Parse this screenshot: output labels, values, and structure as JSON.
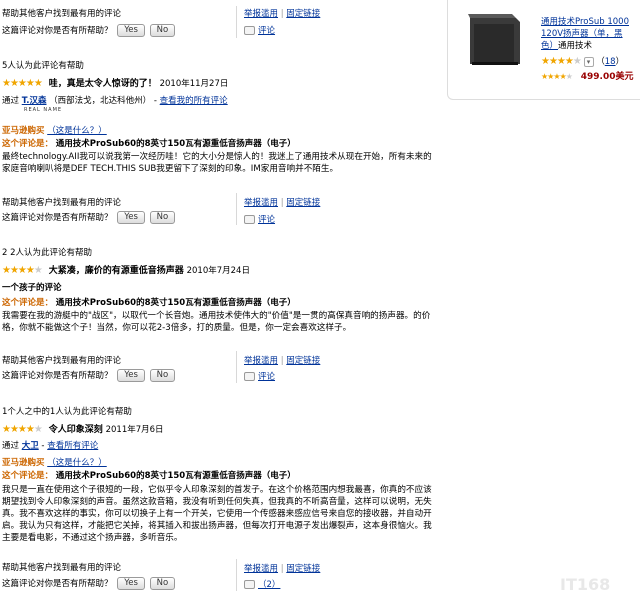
{
  "common": {
    "help_others": "帮助其他客户找到最有用的评论",
    "was_helpful": "这篇评论对你是否有所帮助？",
    "yes": "Yes",
    "no": "No",
    "report_abuse": "举报滥用",
    "permalink": "固定链接",
    "comment": "评论",
    "amazon_verified": "亚马逊购买",
    "whats_this": "（这是什么？）",
    "this_review_is": "这个评论是："
  },
  "product": {
    "title_line1": "通用技术ProSub 1000",
    "title_line2": "120V扬声器（单，黑",
    "title_line3_link": "色）",
    "brand": "通用技术",
    "rating_count_prefix": "（",
    "rating_count": "18",
    "rating_count_suffix": "）",
    "price": "499.00美元"
  },
  "reviews": [
    {
      "helpful_count": "5人认为此评论有帮助",
      "title": "哇，真是太令人惊讶的了！",
      "date": "2010年11月27日",
      "by": "通过",
      "reviewer": "T.汉森",
      "location": "（西部法戈，北达科他州）",
      "dash": " - ",
      "see_all": "查看我的所有评论",
      "real_name": "REAL NAME",
      "product_name": "通用技术ProSub60的8英寸150瓦有源重低音扬声器（电子）",
      "body": "最终technology.AII我可以说我第一次经历哇！它的大小分是惊人的！我迷上了通用技术从现在开始，所有未来的家庭音响喇叭将是DEF TECH.THIS SUB我更留下了深刻的印象。IM家用音响并不陌生。",
      "comment_count": ""
    },
    {
      "helpful_count": "2 2人认为此评论有帮助",
      "title": "大紧凑，廉价的有源重低音扬声器",
      "date": "2010年7月24日",
      "subtitle": "一个孩子的评论",
      "product_name": "通用技术ProSub60的8英寸150瓦有源重低音扬声器（电子）",
      "body": "我需要在我的游艇中的\"战区\"，以取代一个长音炮。通用技术使伟大的\"价值\"是一贯的高保真音响的扬声器。的价格，你就不能做这个子！当然，你可以花2-3倍多，打的质量。但是，你一定会喜欢这样子。",
      "comment_count": ""
    },
    {
      "helpful_count": "1个人之中的1人认为此评论有帮助",
      "title": "令人印象深刻",
      "date": "2011年7月6日",
      "by": "通过",
      "reviewer": "大卫",
      "dash": " - ",
      "see_all": "查看所有评论",
      "product_name": "通用技术ProSub60的8英寸150瓦有源重低音扬声器（电子）",
      "body": "我只是一直在使用这个子很短的一段，它似乎令人印象深刻的首发子。在这个价格范围内想我最喜，你真的不应该期望找到令人印象深刻的声音。虽然这款音箱，我没有听到任何失真，但我真的不听高音量，这样可以说明，无失真。我不喜欢这样的事实，你可以切换子上有一个开关，它使用一个传感器来感应信号来自您的接收器，并自动开启。我认为只有这样，才能把它关掉，将其插入和拔出扬声器，但每次打开电源子发出爆裂声，这本身很恼火。我主要是看电影，不通过这个扬声器，多听音乐。",
      "comment_count": "（2）"
    }
  ],
  "watermark": "IT168"
}
